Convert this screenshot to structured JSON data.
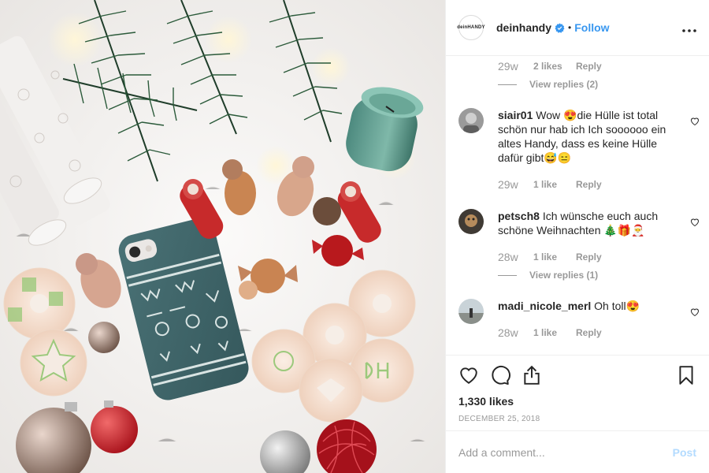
{
  "post": {
    "account": {
      "username": "deinhandy",
      "avatar_text": "deinHANDY",
      "verified": true,
      "follow_label": "Follow",
      "dot": "•",
      "more_label": "•••"
    },
    "comments": [
      {
        "username": "",
        "text": "",
        "time": "29w",
        "likes": "2 likes",
        "reply_label": "Reply",
        "view_replies": "View replies (2)"
      },
      {
        "username": "siair01",
        "text": "Wow 😍die Hülle ist total schön nur hab ich Ich soooooo ein altes Handy, dass es keine Hülle dafür gibt😅😑",
        "time": "29w",
        "likes": "1 like",
        "reply_label": "Reply"
      },
      {
        "username": "petsch8",
        "text": "Ich wünsche euch auch schöne Weihnachten 🎄🎁🎅",
        "time": "28w",
        "likes": "1 like",
        "reply_label": "Reply",
        "view_replies": "View replies (1)"
      },
      {
        "username": "madi_nicole_merl",
        "text": "Oh toll😍",
        "time": "28w",
        "likes": "1 like",
        "reply_label": "Reply"
      }
    ],
    "likes_count": "1,330 likes",
    "date": "DECEMBER 25, 2018",
    "add_comment": {
      "placeholder": "Add a comment...",
      "post_label": "Post"
    },
    "icons": {
      "like": "heart-icon",
      "comment": "comment-icon",
      "share": "share-icon",
      "save": "bookmark-icon",
      "verified": "verified-badge-icon"
    },
    "colors": {
      "link_blue": "#3897f0",
      "post_disabled": "#b3dbff",
      "muted_text": "#999999"
    }
  }
}
